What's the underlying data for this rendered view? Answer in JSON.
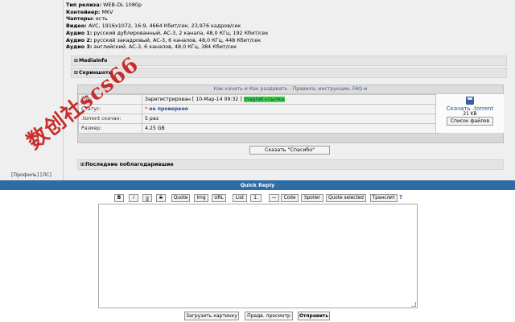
{
  "specs": [
    {
      "label": "Тип релиза:",
      "value": " WEB-DL 1080p"
    },
    {
      "label": "Контейнер:",
      "value": " MKV"
    },
    {
      "label": "Чаптеры:",
      "value": " есть"
    },
    {
      "label": "Видео:",
      "value": " AVC, 1916x1072, 16:9, 4664 Кбит/сек, 23,976 кадров/сек"
    },
    {
      "label": "Аудио 1:",
      "value": " русский дублированный, AC-3, 2 канала, 48,0 КГц, 192 Кбит/сек"
    },
    {
      "label": "Аудио 2:",
      "value": " русский закадровый, AC-3, 6 каналов, 48,0 КГц, 448 Кбит/сек"
    },
    {
      "label": "Аудио 3:",
      "value": " английский, AC-3, 6 каналов, 48,0 КГц, 384 Кбит/сек"
    }
  ],
  "spoilers": {
    "mediainfo": "MediaInfo",
    "screens": "Скриншоты",
    "last_thanked": "Последние поблагодарившие"
  },
  "download": {
    "header": "Как качать и Как раздавать  -  Правила, инструкции, FAQ-и",
    "rows": [
      {
        "label": "Тор:",
        "value": "Зарегистрирован  [ 10-Мар-14 09:32 ]  ",
        "highlight": "magnet-ссылка"
      },
      {
        "label": "Статус:",
        "value": "не проверено"
      },
      {
        "label": ".torrent скачан:",
        "value": "5 раз"
      },
      {
        "label": "Размер:",
        "value": "4.25 GB"
      }
    ],
    "download_label": "Скачать .torrent",
    "file_size": "21 KB",
    "file_list_button": "Список файлов"
  },
  "thanks_button": "Сказать \"Спасибо\"",
  "profile_links": "[Профиль]  [ЛС]",
  "quick_reply_title": "Quick Reply",
  "toolbar": [
    "B",
    "i",
    "u",
    "S",
    "Quote",
    "Img",
    "URL",
    "List",
    "1.",
    "—",
    "Code",
    "Spoiler",
    "Quote selected",
    "Транслит"
  ],
  "help": "?",
  "bottom_buttons": {
    "upload": "Загрузить картинку",
    "preview": "Предв. просмотр",
    "send": "Отправить"
  },
  "watermark": "数创社scs66",
  "colors": {
    "header_bar": "#2f6ca5",
    "link": "#2a4b8d",
    "status_red": "#d00000",
    "magnet_green": "#39d839"
  }
}
